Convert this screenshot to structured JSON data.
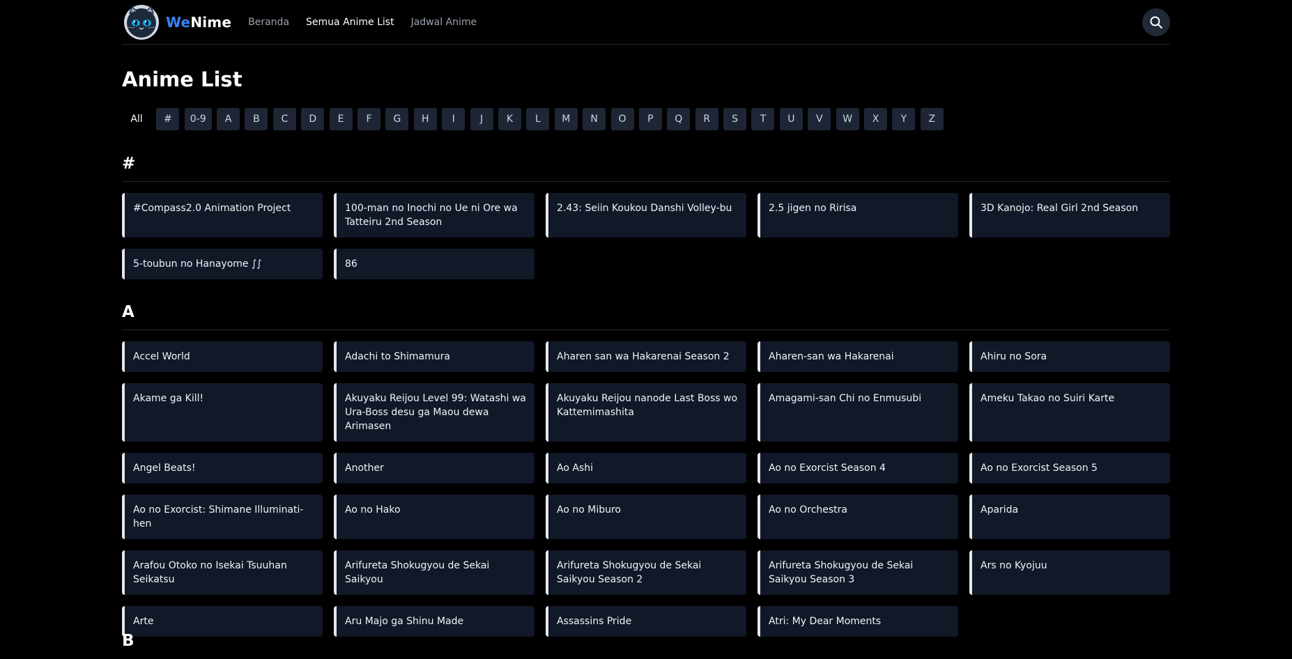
{
  "header": {
    "brand_we": "We",
    "brand_nime": "Nime",
    "nav": [
      {
        "label": "Beranda"
      },
      {
        "label": "Semua Anime List"
      },
      {
        "label": "Jadwal Anime"
      }
    ],
    "search_icon": "search-icon"
  },
  "page": {
    "title": "Anime List"
  },
  "letters": [
    "All",
    "#",
    "0-9",
    "A",
    "B",
    "C",
    "D",
    "E",
    "F",
    "G",
    "H",
    "I",
    "J",
    "K",
    "L",
    "M",
    "N",
    "O",
    "P",
    "Q",
    "R",
    "S",
    "T",
    "U",
    "V",
    "W",
    "X",
    "Y",
    "Z"
  ],
  "sections": [
    {
      "heading": "#",
      "items": [
        "#Compass2.0 Animation Project",
        "100-man no Inochi no Ue ni Ore wa Tatteiru 2nd Season",
        "2.43: Seiin Koukou Danshi Volley-bu",
        "2.5 jigen no Ririsa",
        "3D Kanojo: Real Girl 2nd Season",
        "5-toubun no Hanayome ∫∫",
        "86"
      ]
    },
    {
      "heading": "A",
      "items": [
        "Accel World",
        "Adachi to Shimamura",
        "Aharen san wa Hakarenai Season 2",
        "Aharen-san wa Hakarenai",
        "Ahiru no Sora",
        "Akame ga Kill!",
        "Akuyaku Reijou Level 99: Watashi wa Ura-Boss desu ga Maou dewa Arimasen",
        "Akuyaku Reijou nanode Last Boss wo Kattemimashita",
        "Amagami-san Chi no Enmusubi",
        "Ameku Takao no Suiri Karte",
        "Angel Beats!",
        "Another",
        "Ao Ashi",
        "Ao no Exorcist Season 4",
        "Ao no Exorcist Season 5",
        "Ao no Exorcist: Shimane Illuminati-hen",
        "Ao no Hako",
        "Ao no Miburo",
        "Ao no Orchestra",
        "Aparida",
        "Arafou Otoko no Isekai Tsuuhan Seikatsu",
        "Arifureta Shokugyou de Sekai Saikyou",
        "Arifureta Shokugyou de Sekai Saikyou Season 2",
        "Arifureta Shokugyou de Sekai Saikyou Season 3",
        "Ars no Kyojuu",
        "Arte",
        "Aru Majo ga Shinu Made",
        "Assassins Pride",
        "Atri: My Dear Moments"
      ]
    },
    {
      "heading": "B",
      "items": []
    }
  ],
  "colors": {
    "background": "#000000",
    "card": "#111827",
    "accent": "#3b82f6",
    "card_border": "#e5e7eb"
  }
}
